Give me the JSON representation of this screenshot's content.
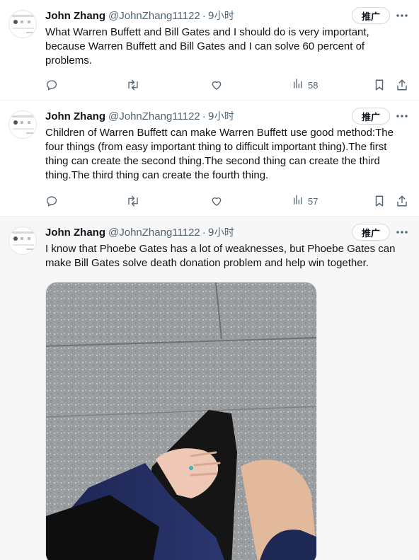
{
  "tweets": [
    {
      "name": "John Zhang",
      "handle": "@JohnZhang11122",
      "separator": "·",
      "time": "9小时",
      "promote_label": "推广",
      "text": "What Warren Buffett and Bill Gates and I should do is very important, because Warren Buffett and Bill Gates and I can solve 60 percent of problems.",
      "views": "58"
    },
    {
      "name": "John Zhang",
      "handle": "@JohnZhang11122",
      "separator": "·",
      "time": "9小时",
      "promote_label": "推广",
      "text": "Children of Warren Buffett can make Warren Buffett use good method:The four things (from easy important thing to difficult important thing).The first thing can create the second thing.The second thing can create the third thing.The third thing can create the fourth thing.",
      "views": "57"
    },
    {
      "name": "John Zhang",
      "handle": "@JohnZhang11122",
      "separator": "·",
      "time": "9小时",
      "promote_label": "推广",
      "text": "I know that Phoebe Gates has a lot of weaknesses, but Phoebe Gates can make Bill Gates solve death donation problem and help win together."
    }
  ],
  "icons": {
    "reply": "reply-icon",
    "retweet": "retweet-icon",
    "like": "heart-icon",
    "views": "views-icon",
    "bookmark": "bookmark-icon",
    "share": "share-icon",
    "more": "more-dots-icon"
  },
  "colors": {
    "text": "#0f1419",
    "muted": "#536471",
    "divider": "#eff3f4",
    "highlight_bg": "#f7f7f7"
  }
}
